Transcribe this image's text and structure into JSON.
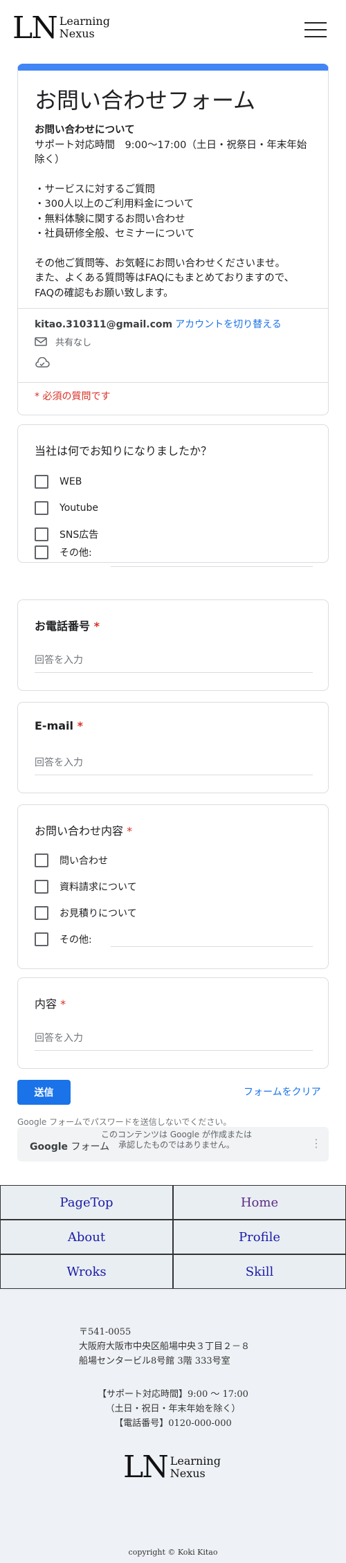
{
  "brand": {
    "initials": "LN",
    "line1": "Learning",
    "line2": "Nexus"
  },
  "form": {
    "title": "お問い合わせフォーム",
    "about_heading": "お問い合わせについて",
    "hours": "サポート対応時間　9:00～17:00（土日・祝祭日・年末年始除く）",
    "topics": [
      "・サービスに対するご質問",
      "・300人以上のご利用料金について",
      "・無料体験に関するお問い合わせ",
      "・社員研修全般、セミナーについて"
    ],
    "closing1": "その他ご質問等、お気軽にお問い合わせくださいませ。",
    "closing2": "また、よくある質問等はFAQにもまとめておりますので、FAQの確認もお願い致します。",
    "account_email": "kitao.310311@gmail.com",
    "switch_account": "アカウントを切り替える",
    "not_shared": "共有なし",
    "required_note": "* 必須の質問です"
  },
  "q_source": {
    "title": "当社は何でお知りになりましたか？",
    "options": [
      "WEB",
      "Youtube",
      "SNS広告",
      "その他:"
    ]
  },
  "q_phone": {
    "title": "お電話番号",
    "placeholder": "回答を入力"
  },
  "q_email": {
    "title": "E-mail",
    "placeholder": "回答を入力"
  },
  "q_type": {
    "title": "お問い合わせ内容",
    "options": [
      "問い合わせ",
      "資料請求について",
      "お見積りについて",
      "その他:"
    ]
  },
  "q_body": {
    "title": "内容",
    "placeholder": "回答を入力"
  },
  "required_star": "*",
  "actions": {
    "submit": "送信",
    "clear": "フォームをクリア"
  },
  "google": {
    "password_note": "Google フォームでパスワードを送信しないでください。",
    "brand_google": "Google",
    "brand_forms": "フォーム",
    "disclaimer": "このコンテンツは Google が作成または承認したものではありません。",
    "more": "⋮"
  },
  "nav": [
    "PageTop",
    "Home",
    "About",
    "Profile",
    "Wroks",
    "Skill"
  ],
  "footer": {
    "zip": "〒541-0055",
    "addr1": "大阪府大阪市中央区船場中央３丁目２－８",
    "addr2": "船場センタービル8号館 3階 333号室",
    "support1": "【サポート対応時間】9:00 ～ 17:00",
    "support2": "（土日・祝日・年末年始を除く）",
    "support3": "【電話番号】0120-000-000",
    "copyright": "copyright © Koki Kitao"
  },
  "colors": {
    "accent": "#4285f4",
    "link": "#1a73e8",
    "required": "#d93025",
    "nav_text": "#1a1aa6"
  }
}
